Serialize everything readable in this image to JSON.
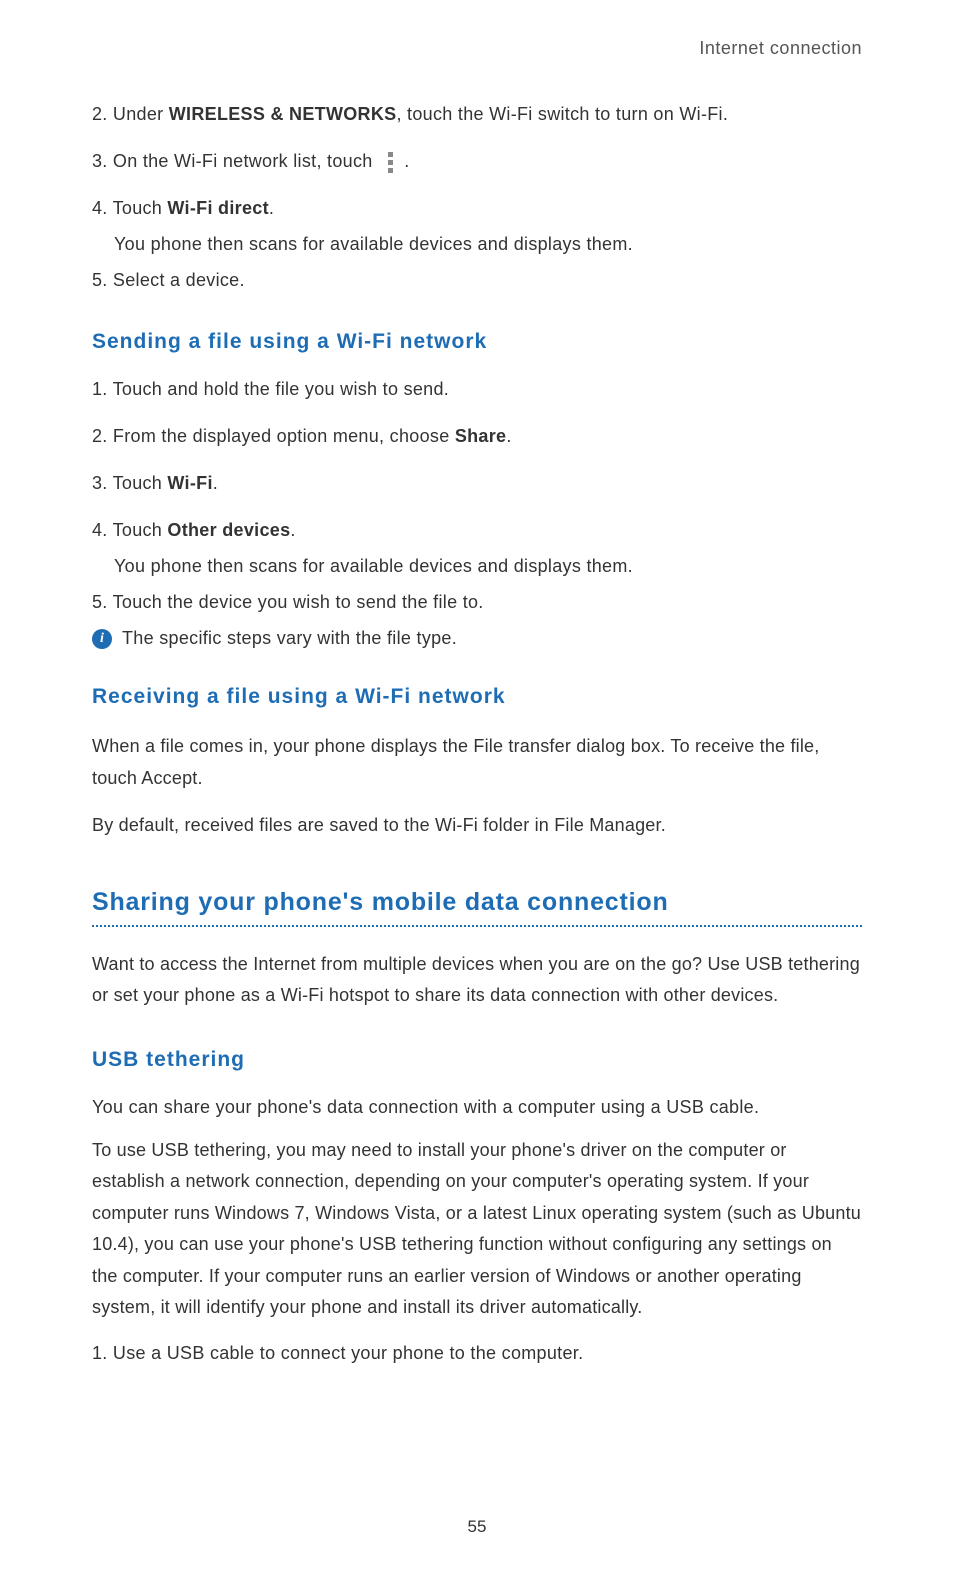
{
  "header": {
    "label": "Internet connection"
  },
  "block1": {
    "step2_a": "2. Under ",
    "step2_bold": "WIRELESS & NETWORKS",
    "step2_b": ", touch the Wi-Fi switch to turn on Wi-Fi.",
    "step3_a": "3. On the Wi-Fi network list, touch ",
    "step3_b": " .",
    "step4_a": "4. Touch ",
    "step4_bold": "Wi-Fi direct",
    "step4_b": ".",
    "step4_sub": "You phone then scans for available devices and displays them.",
    "step5": "5. Select a device."
  },
  "sending": {
    "heading": "Sending a file using a Wi-Fi network",
    "step1": "1. Touch and hold the file you wish to send.",
    "step2_a": "2. From the displayed option menu, choose ",
    "step2_bold": "Share",
    "step2_b": ".",
    "step3_a": "3. Touch ",
    "step3_bold": "Wi-Fi",
    "step3_b": ".",
    "step4_a": "4. Touch ",
    "step4_bold": "Other devices",
    "step4_b": ".",
    "step4_sub": "You phone then scans for available devices and displays them.",
    "step5": "5. Touch the device you wish to send the file to.",
    "note": "The specific steps vary with the file type."
  },
  "receiving": {
    "heading": "Receiving a file using a Wi-Fi network",
    "p1_a": "When a file comes in, your phone displays the ",
    "p1_bold1": "File transfer",
    "p1_b": " dialog box. To receive the file, touch ",
    "p1_bold2": "Accept",
    "p1_c": ".",
    "p2_a": "By default, received files are saved to the ",
    "p2_bold1": "Wi-Fi",
    "p2_b": " folder in ",
    "p2_bold2": "File Manager",
    "p2_c": "."
  },
  "sharing": {
    "heading": "Sharing your phone's mobile data connection",
    "intro": "Want to access the Internet from multiple devices when you are on the go? Use USB tethering or set your phone as a Wi-Fi hotspot to share its data connection with other devices."
  },
  "usb": {
    "heading": "USB tethering",
    "p1": "You can share your phone's data connection with a computer using a USB cable.",
    "p2": "To use USB tethering, you may need to install your phone's driver on the computer or establish a network connection, depending on your computer's operating system. If your computer runs Windows 7, Windows Vista, or a latest Linux operating system (such as Ubuntu 10.4), you can use your phone's USB tethering function without configuring any settings on the computer. If your computer runs an earlier version of Windows or another operating system, it will identify your phone and install its driver automatically.",
    "step1": "1. Use a USB cable to connect your phone to the computer."
  },
  "page_number": "55",
  "icons": {
    "info_glyph": "i"
  }
}
